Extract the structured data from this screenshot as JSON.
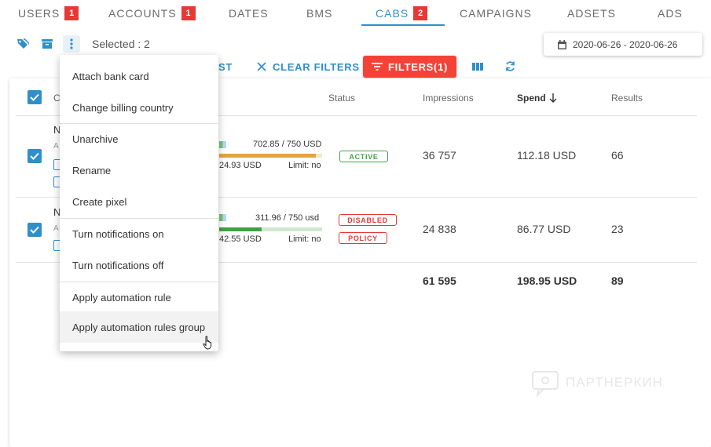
{
  "tabs": [
    {
      "label": "USERS",
      "badge": "1"
    },
    {
      "label": "ACCOUNTS",
      "badge": "1"
    },
    {
      "label": "DATES",
      "badge": ""
    },
    {
      "label": "BMS",
      "badge": ""
    },
    {
      "label": "CABS",
      "badge": "2"
    },
    {
      "label": "CAMPAIGNS",
      "badge": ""
    },
    {
      "label": "ADSETS",
      "badge": ""
    },
    {
      "label": "ADS",
      "badge": ""
    }
  ],
  "toolbar": {
    "selected_text": "Selected : 2",
    "date_range": "2020-06-26 - 2020-06-26",
    "partial_button": "ST",
    "clear_filters": "CLEAR FILTERS",
    "filters": "FILTERS(1)"
  },
  "table": {
    "headers": {
      "first": "C",
      "status": "Status",
      "impressions": "Impressions",
      "spend": "Spend",
      "results": "Results"
    },
    "rows": [
      {
        "name_initial": "N",
        "sub_initial": "A",
        "limit_text": "702.85 / 750 USD",
        "spent_text": "24.93 USD",
        "limit_flag": "Limit: no",
        "progress": 0.937,
        "statuses": [
          "ACTIVE"
        ],
        "impressions": "36 757",
        "spend": "112.18 USD",
        "results": "66"
      },
      {
        "name_initial": "N",
        "sub_initial": "A",
        "limit_text": "311.96 / 750 usd",
        "spent_text": "42.55 USD",
        "limit_flag": "Limit: no",
        "progress": 0.416,
        "statuses": [
          "DISABLED",
          "POLICY"
        ],
        "impressions": "24 838",
        "spend": "86.77 USD",
        "results": "23"
      }
    ],
    "totals": {
      "impressions": "61 595",
      "spend": "198.95 USD",
      "results": "89"
    }
  },
  "menu": {
    "items": [
      "Attach bank card",
      "Change billing country",
      "Unarchive",
      "Rename",
      "Create pixel",
      "Turn notifications on",
      "Turn notifications off",
      "Apply automation rule",
      "Apply automation rules group"
    ]
  },
  "watermark": "ПАРТНЕРКИН",
  "colors": {
    "accent": "#2f8fc9",
    "danger": "#f44336",
    "badge": "#e53935",
    "active": "#43a047",
    "progress": "#e6a23c"
  }
}
